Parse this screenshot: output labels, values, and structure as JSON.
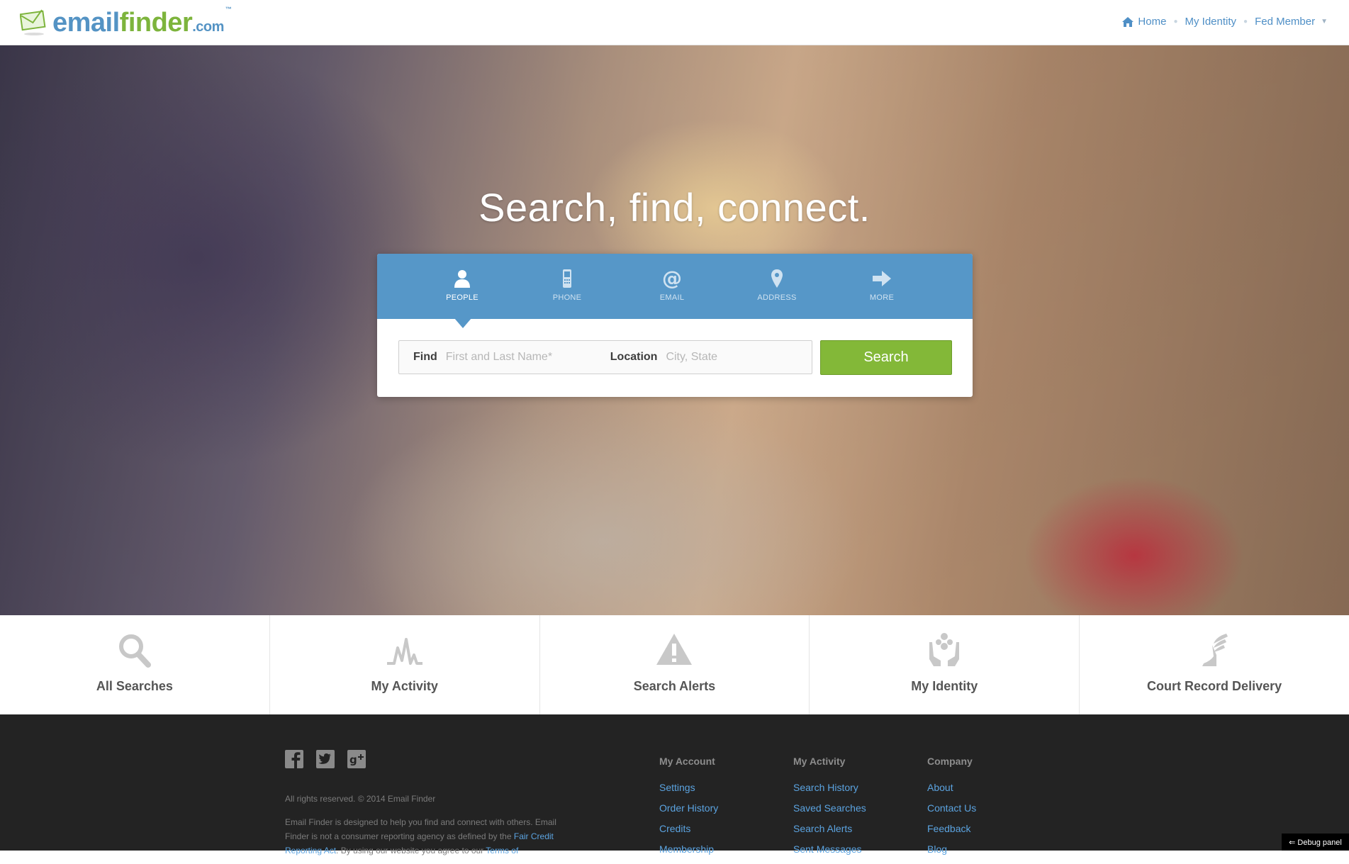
{
  "header": {
    "logo": {
      "part1": "email",
      "part2": "finder",
      "part3": ".com",
      "tm": "™"
    },
    "nav": {
      "home": "Home",
      "identity": "My Identity",
      "member": "Fed Member"
    }
  },
  "hero": {
    "title": "Search, find, connect."
  },
  "search": {
    "tabs": [
      {
        "label": "PEOPLE",
        "icon": "person-icon",
        "active": true
      },
      {
        "label": "PHONE",
        "icon": "phone-icon",
        "active": false
      },
      {
        "label": "EMAIL",
        "icon": "at-icon",
        "active": false
      },
      {
        "label": "ADDRESS",
        "icon": "map-pin-icon",
        "active": false
      },
      {
        "label": "MORE",
        "icon": "arrow-right-icon",
        "active": false
      }
    ],
    "find_label": "Find",
    "find_placeholder": "First and Last Name*",
    "location_label": "Location",
    "location_placeholder": "City, State",
    "button": "Search"
  },
  "quicklinks": [
    {
      "label": "All Searches",
      "icon": "magnifier-icon"
    },
    {
      "label": "My Activity",
      "icon": "activity-icon"
    },
    {
      "label": "Search Alerts",
      "icon": "alert-icon"
    },
    {
      "label": "My Identity",
      "icon": "identity-hands-icon"
    },
    {
      "label": "Court Record Delivery",
      "icon": "winged-foot-icon"
    }
  ],
  "footer": {
    "social": [
      "facebook-icon",
      "twitter-icon",
      "google-plus-icon"
    ],
    "copyright": "All rights reserved. © 2014 Email Finder",
    "disclaimer": {
      "text1": "Email Finder is designed to help you find and connect with others. Email Finder is not a consumer reporting agency as defined by the ",
      "link1": "Fair Credit Reporting Act",
      "text2": ". By using our website you agree to our ",
      "link2": "Terms of"
    },
    "columns": [
      {
        "title": "My Account",
        "links": [
          "Settings",
          "Order History",
          "Credits",
          "Membership"
        ]
      },
      {
        "title": "My Activity",
        "links": [
          "Search History",
          "Saved Searches",
          "Search Alerts",
          "Sent Messages"
        ]
      },
      {
        "title": "Company",
        "links": [
          "About",
          "Contact Us",
          "Feedback",
          "Blog"
        ]
      }
    ],
    "debug": "⇐ Debug panel"
  },
  "colors": {
    "brand_blue": "#5493c4",
    "brand_green": "#7db43c",
    "tab_bar": "#5697c8",
    "search_button": "#83b838",
    "footer_bg": "#232323",
    "link_blue": "#5ba3e0"
  }
}
